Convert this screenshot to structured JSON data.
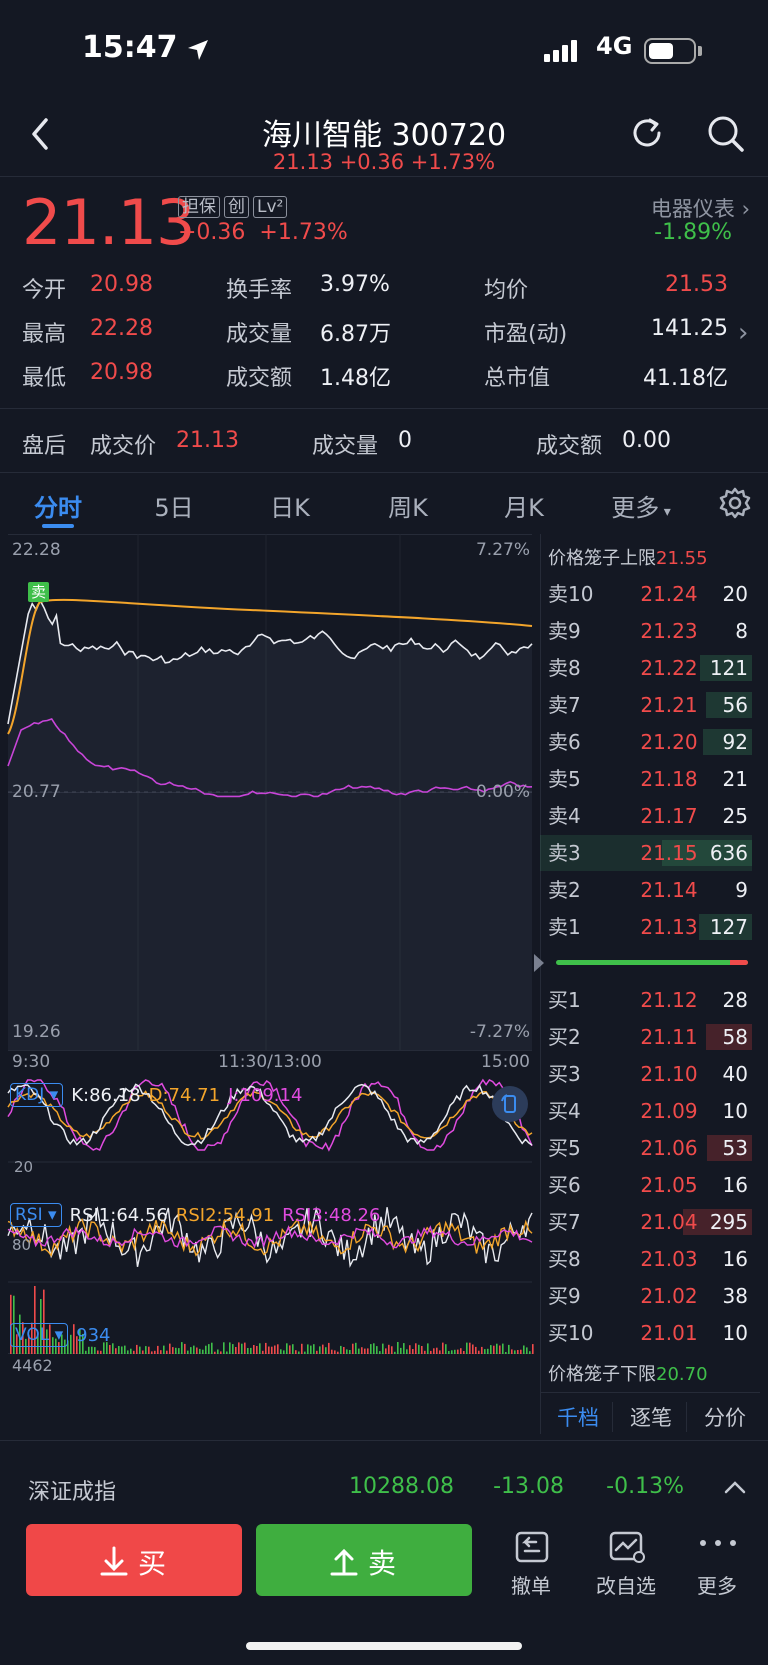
{
  "status_bar": {
    "time": "15:47",
    "network": "4G"
  },
  "header": {
    "title": "海川智能 300720",
    "subtitle": "21.13 +0.36 +1.73%"
  },
  "quote": {
    "price": "21.13",
    "tags": [
      "担保",
      "创",
      "Lv²"
    ],
    "change": "+0.36",
    "change_pct": "+1.73%",
    "sector": "电器仪表",
    "sector_change": "-1.89%"
  },
  "stats": [
    {
      "label": "今开",
      "value": "20.98",
      "color": "red"
    },
    {
      "label": "换手率",
      "value": "3.97%",
      "color": "white"
    },
    {
      "label": "均价",
      "value": "21.53",
      "color": "red"
    },
    {
      "label": "最高",
      "value": "22.28",
      "color": "red"
    },
    {
      "label": "成交量",
      "value": "6.87万",
      "color": "white"
    },
    {
      "label": "市盈(动)",
      "value": "141.25",
      "color": "white"
    },
    {
      "label": "最低",
      "value": "20.98",
      "color": "red"
    },
    {
      "label": "成交额",
      "value": "1.48亿",
      "color": "white"
    },
    {
      "label": "总市值",
      "value": "41.18亿",
      "color": "white"
    }
  ],
  "post_market": {
    "label": "盘后",
    "price_label": "成交价",
    "price": "21.13",
    "volume_label": "成交量",
    "volume": "0",
    "amount_label": "成交额",
    "amount": "0.00"
  },
  "tabs": [
    "分时",
    "5日",
    "日K",
    "周K",
    "月K",
    "更多"
  ],
  "chart": {
    "y_top": "22.28",
    "y_mid": "20.77",
    "y_bottom": "19.26",
    "pct_top": "7.27%",
    "pct_mid": "0.00%",
    "pct_bottom": "-7.27%",
    "x_start": "9:30",
    "x_mid": "11:30/13:00",
    "x_end": "15:00",
    "marker": "卖",
    "kdj": {
      "tag": "KDJ",
      "k": "K:86.18",
      "d": "D:74.71",
      "j": "J:109.14",
      "axis": "20"
    },
    "rsi": {
      "tag": "RSI",
      "r1": "RSI1:64.56",
      "r2": "RSI2:54.91",
      "r3": "RSI3:48.26",
      "axis": "80"
    },
    "vol": {
      "tag": "VOL",
      "value": "934",
      "axis": "4462"
    }
  },
  "order_book": {
    "upper_limit_label": "价格笼子上限",
    "upper_limit": "21.55",
    "lower_limit_label": "价格笼子下限",
    "lower_limit": "20.70",
    "asks": [
      {
        "label": "卖10",
        "price": "21.24",
        "vol": "20"
      },
      {
        "label": "卖9",
        "price": "21.23",
        "vol": "8"
      },
      {
        "label": "卖8",
        "price": "21.22",
        "vol": "121"
      },
      {
        "label": "卖7",
        "price": "21.21",
        "vol": "56"
      },
      {
        "label": "卖6",
        "price": "21.20",
        "vol": "92"
      },
      {
        "label": "卖5",
        "price": "21.18",
        "vol": "21"
      },
      {
        "label": "卖4",
        "price": "21.17",
        "vol": "25"
      },
      {
        "label": "卖3",
        "price": "21.15",
        "vol": "636"
      },
      {
        "label": "卖2",
        "price": "21.14",
        "vol": "9"
      },
      {
        "label": "卖1",
        "price": "21.13",
        "vol": "127"
      }
    ],
    "bids": [
      {
        "label": "买1",
        "price": "21.12",
        "vol": "28"
      },
      {
        "label": "买2",
        "price": "21.11",
        "vol": "58"
      },
      {
        "label": "买3",
        "price": "21.10",
        "vol": "40"
      },
      {
        "label": "买4",
        "price": "21.09",
        "vol": "10"
      },
      {
        "label": "买5",
        "price": "21.06",
        "vol": "53"
      },
      {
        "label": "买6",
        "price": "21.05",
        "vol": "16"
      },
      {
        "label": "买7",
        "price": "21.04",
        "vol": "295"
      },
      {
        "label": "买8",
        "price": "21.03",
        "vol": "16"
      },
      {
        "label": "买9",
        "price": "21.02",
        "vol": "38"
      },
      {
        "label": "买10",
        "price": "21.01",
        "vol": "10"
      }
    ],
    "tabs": [
      "千档",
      "逐笔",
      "分价"
    ]
  },
  "index_bar": {
    "name": "深证成指",
    "value": "10288.08",
    "change": "-13.08",
    "change_pct": "-0.13%"
  },
  "actions": {
    "buy": "买",
    "sell": "卖",
    "cancel": "撤单",
    "watchlist": "改自选",
    "more": "更多"
  }
}
